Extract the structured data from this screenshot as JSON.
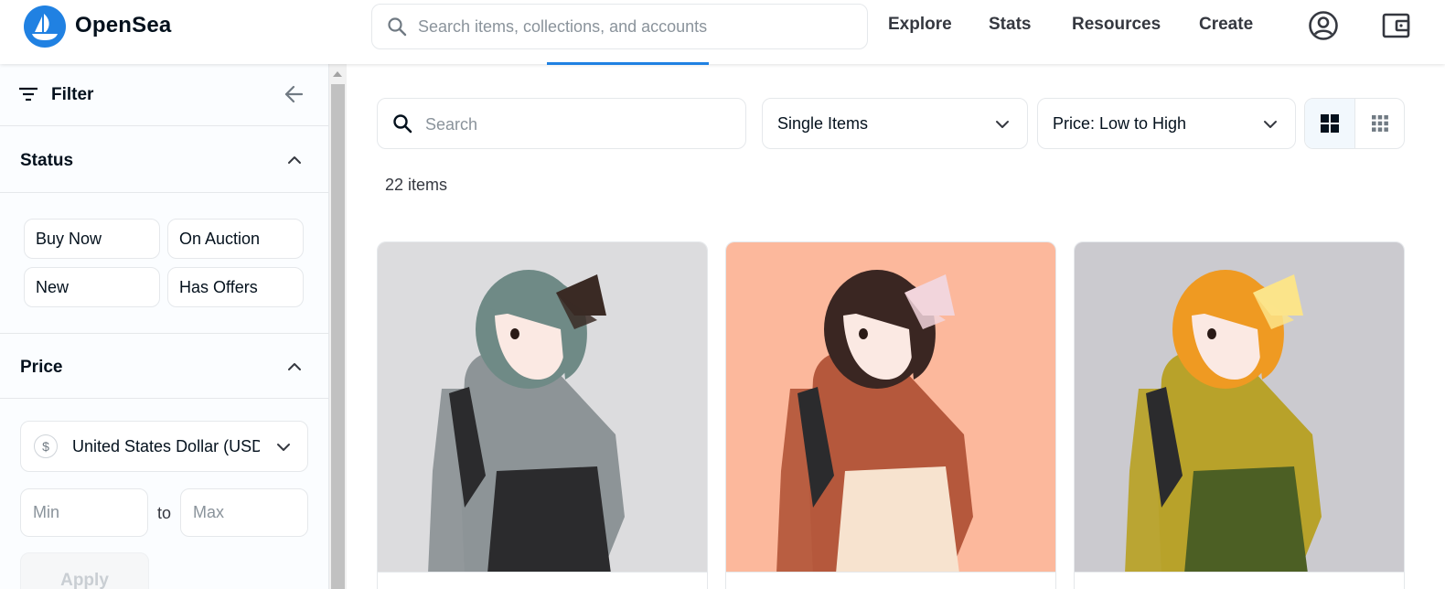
{
  "header": {
    "brand": "OpenSea",
    "search_placeholder": "Search items, collections, and accounts",
    "nav": [
      "Explore",
      "Stats",
      "Resources",
      "Create"
    ]
  },
  "sidebar": {
    "filter_label": "Filter",
    "status": {
      "title": "Status",
      "options": [
        "Buy Now",
        "On Auction",
        "New",
        "Has Offers"
      ]
    },
    "price": {
      "title": "Price",
      "currency_symbol": "$",
      "currency": "United States Dollar (USD)",
      "min_placeholder": "Min",
      "to_label": "to",
      "max_placeholder": "Max",
      "apply_label": "Apply"
    }
  },
  "main": {
    "search_placeholder": "Search",
    "type_filter": "Single Items",
    "sort": "Price: Low to High",
    "item_count": "22 items",
    "cards": [
      {
        "bg": "#dcdcde",
        "hair": "#6f8a86",
        "bow": "#3a2a24",
        "kimono": "#8d9497",
        "skirt": "#2b2b2d"
      },
      {
        "bg": "#fcb89c",
        "hair": "#3a2622",
        "bow": "#f2d5dc",
        "kimono": "#b5583c",
        "skirt": "#f7e3cf"
      },
      {
        "bg": "#cbcacf",
        "hair": "#ef9a22",
        "bow": "#fbe48a",
        "kimono": "#b8a22a",
        "skirt": "#4c5f24"
      }
    ]
  },
  "colors": {
    "accent": "#2081e2",
    "text": "#04111d",
    "border": "#e5e8eb"
  },
  "icons": [
    "opensea-logo-icon",
    "search-icon",
    "account-icon",
    "wallet-icon",
    "filter-icon",
    "back-arrow-icon",
    "chevron-up-icon",
    "chevron-down-icon",
    "grid-large-icon",
    "grid-small-icon"
  ]
}
